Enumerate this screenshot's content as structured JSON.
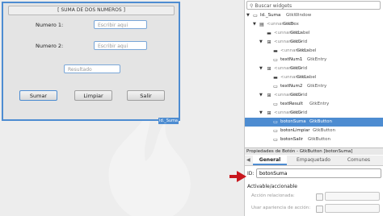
{
  "colors": {
    "accent": "#4d8cd1",
    "arrow": "#c8161d"
  },
  "window": {
    "frame_title": "[ SUMA DE DOS NUMEROS ]",
    "label1": "Numero 1:",
    "label2": "Numero 2:",
    "entry1_placeholder": "Escribir aqui",
    "entry2_placeholder": "Escribir aqui",
    "result_placeholder": "Resultado",
    "btn_sumar": "Sumar",
    "btn_limpiar": "Limpiar",
    "btn_salir": "Salir",
    "tag": "Id._Suma"
  },
  "sidebar": {
    "search_placeholder": "Buscar widgets",
    "tree": [
      {
        "name": "Id._Suma",
        "cls": "GtkWindow"
      },
      {
        "name": "",
        "cls": "GtkBox",
        "placeholder": "<unnamed>"
      },
      {
        "name": "",
        "cls": "GtkLabel",
        "placeholder": "<unnamed>"
      },
      {
        "name": "",
        "cls": "GtkGrid",
        "placeholder": "<unnamed>"
      },
      {
        "name": "",
        "cls": "GtkLabel",
        "placeholder": "<unnamed>"
      },
      {
        "name": "textNum1",
        "cls": "GtkEntry"
      },
      {
        "name": "",
        "cls": "GtkGrid",
        "placeholder": "<unnamed>"
      },
      {
        "name": "",
        "cls": "GtkLabel",
        "placeholder": "<unnamed>"
      },
      {
        "name": "textNum2",
        "cls": "GtkEntry"
      },
      {
        "name": "",
        "cls": "GtkGrid",
        "placeholder": "<unnamed>"
      },
      {
        "name": "textResult",
        "cls": "GtkEntry"
      },
      {
        "name": "",
        "cls": "GtkGrid",
        "placeholder": "<unnamed>"
      },
      {
        "name": "botonSuma",
        "cls": "GtkButton"
      },
      {
        "name": "botonLimpiar",
        "cls": "GtkButton"
      },
      {
        "name": "botonSalir",
        "cls": "GtkButton"
      }
    ]
  },
  "props": {
    "header": "Propiedades de Botón - GtkButton [botonSuma]",
    "tabs": [
      "General",
      "Empaquetado",
      "Comunes"
    ],
    "id_label": "ID:",
    "id_value": "botonSuma",
    "section": "Activable/accionable",
    "row1": "Acción relacionada:",
    "row2": "Usar apariencia de acción:"
  }
}
